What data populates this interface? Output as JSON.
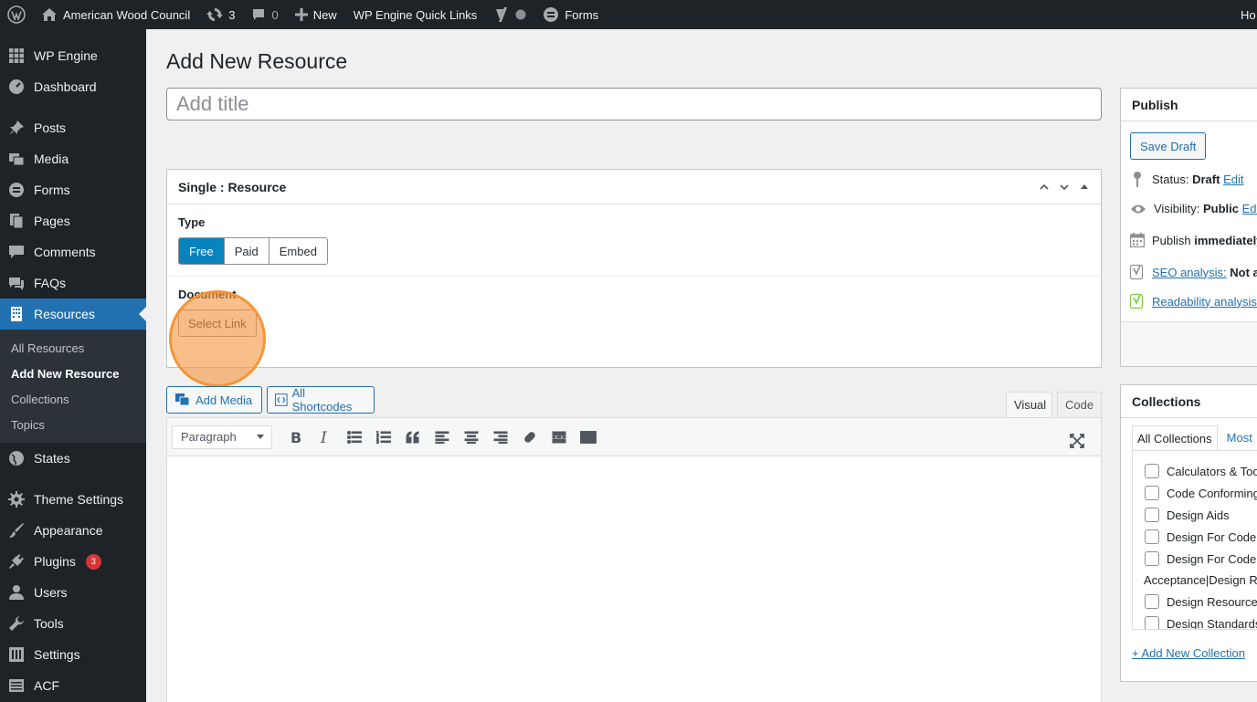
{
  "adminbar": {
    "site_name": "American Wood Council",
    "updates_count": "3",
    "comments_count": "0",
    "new_label": "New",
    "quick_links_label": "WP Engine Quick Links",
    "forms_label": "Forms",
    "howdy_label": "Ho"
  },
  "sidebar": {
    "items": [
      {
        "label": "WP Engine"
      },
      {
        "label": "Dashboard"
      },
      {
        "label": "Posts"
      },
      {
        "label": "Media"
      },
      {
        "label": "Forms"
      },
      {
        "label": "Pages"
      },
      {
        "label": "Comments"
      },
      {
        "label": "FAQs"
      },
      {
        "label": "Resources"
      },
      {
        "label": "States"
      },
      {
        "label": "Theme Settings"
      },
      {
        "label": "Appearance"
      },
      {
        "label": "Plugins",
        "badge": "3"
      },
      {
        "label": "Users"
      },
      {
        "label": "Tools"
      },
      {
        "label": "Settings"
      },
      {
        "label": "ACF"
      }
    ],
    "resources_sub": [
      "All Resources",
      "Add New Resource",
      "Collections",
      "Topics"
    ]
  },
  "main": {
    "page_title": "Add New Resource",
    "title_placeholder": "Add title",
    "acf_box": {
      "title": "Single : Resource",
      "type_label": "Type",
      "type_options": [
        "Free",
        "Paid",
        "Embed"
      ],
      "type_selected": "Free",
      "document_label": "Document",
      "select_link_label": "Select Link"
    },
    "add_media_label": "Add Media",
    "all_shortcodes_label": "All Shortcodes",
    "tab_visual": "Visual",
    "tab_code": "Code",
    "format_select_value": "Paragraph"
  },
  "publish": {
    "title": "Publish",
    "save_draft_label": "Save Draft",
    "status_label": "Status:",
    "status_value": "Draft",
    "edit_label": "Edit",
    "visibility_label": "Visibility:",
    "visibility_value": "Public",
    "visibility_edit": "Edit",
    "publish_label": "Publish",
    "publish_value": "immediately",
    "seo_label": "SEO analysis:",
    "seo_value": "Not av",
    "readability_label": "Readability analysis:"
  },
  "collections": {
    "title": "Collections",
    "tab_all": "All Collections",
    "tab_most": "Most",
    "items": [
      "Calculators & Too",
      "Code Conforming",
      "Design Aids",
      "Design For Code A",
      "Design For Code",
      "Design Resources",
      "Design Standards"
    ],
    "wrapped_text": "Acceptance|Design Re",
    "add_new_label": "+ Add New Collection"
  },
  "colors": {
    "adminbar_bg": "#1d2327",
    "accent": "#2271b1",
    "acf_selected": "#0783be",
    "highlight": "#f69842",
    "badge": "#d63638"
  }
}
